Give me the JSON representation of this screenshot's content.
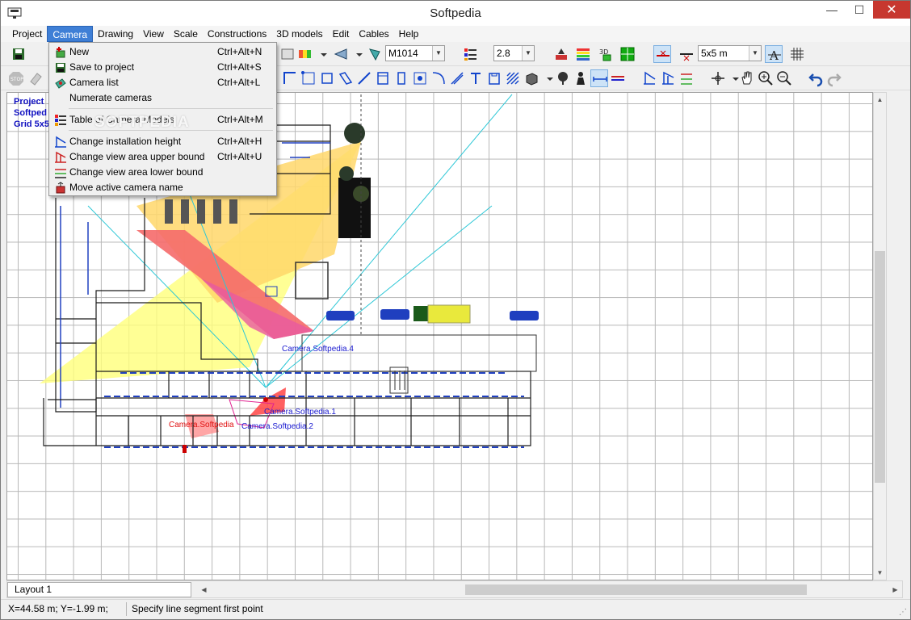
{
  "window": {
    "title": "Softpedia"
  },
  "menubar": [
    {
      "label": "Project",
      "active": false
    },
    {
      "label": "Camera",
      "active": true
    },
    {
      "label": "Drawing",
      "active": false
    },
    {
      "label": "View",
      "active": false
    },
    {
      "label": "Scale",
      "active": false
    },
    {
      "label": "Constructions",
      "active": false
    },
    {
      "label": "3D models",
      "active": false
    },
    {
      "label": "Edit",
      "active": false
    },
    {
      "label": "Cables",
      "active": false
    },
    {
      "label": "Help",
      "active": false
    }
  ],
  "toolbar": {
    "camera_model": "M1014",
    "focal_length": "2.8",
    "grid_size": "5x5 m"
  },
  "camera_menu": {
    "items": [
      {
        "label": "New",
        "shortcut": "Ctrl+Alt+N",
        "icon": "new-camera-icon"
      },
      {
        "label": "Save to project",
        "shortcut": "Ctrl+Alt+S",
        "icon": "save-icon"
      },
      {
        "label": "Camera list",
        "shortcut": "Ctrl+Alt+L",
        "icon": "camera-list-icon"
      },
      {
        "label": "Numerate cameras",
        "shortcut": "",
        "icon": ""
      },
      {
        "label": "Table of Camera Models",
        "shortcut": "Ctrl+Alt+M",
        "icon": "table-icon"
      },
      {
        "label": "Change installation height",
        "shortcut": "Ctrl+Alt+H",
        "icon": "height-icon"
      },
      {
        "label": "Change view area upper bound",
        "shortcut": "Ctrl+Alt+U",
        "icon": "upper-bound-icon"
      },
      {
        "label": "Change view area lower bound",
        "shortcut": "",
        "icon": "lower-bound-icon"
      },
      {
        "label": "Move active camera name",
        "shortcut": "",
        "icon": "move-name-icon"
      }
    ],
    "watermark": "SOFTPEDIA"
  },
  "canvas": {
    "info_lines": [
      "Project",
      "Softped",
      "Grid 5x5"
    ],
    "camera_labels": [
      {
        "text": "Camera.Softpedia.4",
        "color": "#1a1ad0"
      },
      {
        "text": "Camera.Softpedia.1",
        "color": "#1a1ad0"
      },
      {
        "text": "Camera.Softpedia",
        "color": "#e01010"
      },
      {
        "text": "Camera.Softpedia.2",
        "color": "#1a1ad0"
      }
    ]
  },
  "layout_tab": "Layout 1",
  "status": {
    "coords": "X=44.58 m; Y=-1.99 m;",
    "message": "Specify line segment first point"
  }
}
